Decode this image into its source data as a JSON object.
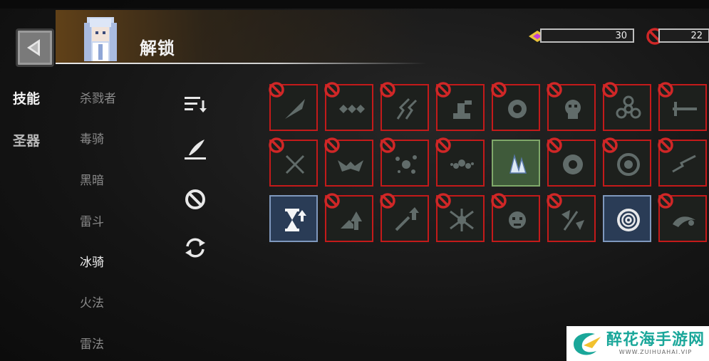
{
  "header": {
    "title": "解锁"
  },
  "resources": [
    {
      "icon": "gem-icon",
      "value": "30"
    },
    {
      "icon": "forbidden-icon",
      "value": "22"
    }
  ],
  "nav": [
    {
      "label": "技能",
      "active": true
    },
    {
      "label": "圣器",
      "active": false
    }
  ],
  "classes": [
    "杀戮者",
    "毒骑",
    "黑暗",
    "雷斗",
    "冰骑",
    "火法",
    "雷法"
  ],
  "selected_class": "冰骑",
  "tools": [
    "sort-icon",
    "feather-icon",
    "ban-filter-icon",
    "refresh-icon"
  ],
  "skills": [
    [
      {
        "icon": "slash-icon",
        "state": "locked"
      },
      {
        "icon": "spiked-chain-icon",
        "state": "locked"
      },
      {
        "icon": "lightning-claw-icon",
        "state": "locked"
      },
      {
        "icon": "fist-strike-icon",
        "state": "locked"
      },
      {
        "icon": "fire-fist-icon",
        "state": "locked"
      },
      {
        "icon": "skull-burst-icon",
        "state": "locked"
      },
      {
        "icon": "biohazard-icon",
        "state": "locked"
      },
      {
        "icon": "lance-icon",
        "state": "locked"
      }
    ],
    [
      {
        "icon": "crossed-swords-icon",
        "state": "locked"
      },
      {
        "icon": "bat-wings-icon",
        "state": "locked"
      },
      {
        "icon": "splatter-icon",
        "state": "locked"
      },
      {
        "icon": "dust-cloud-icon",
        "state": "locked"
      },
      {
        "icon": "ice-crystal-icon",
        "state": "unlocked-green"
      },
      {
        "icon": "whirlwind-icon",
        "state": "locked"
      },
      {
        "icon": "ring-icon",
        "state": "locked"
      },
      {
        "icon": "lightning-bolt-icon",
        "state": "locked"
      }
    ],
    [
      {
        "icon": "hourglass-up-icon",
        "state": "unlocked-blue"
      },
      {
        "icon": "upgrade-arrows-icon",
        "state": "locked"
      },
      {
        "icon": "sword-upgrade-icon",
        "state": "locked"
      },
      {
        "icon": "spike-burst-icon",
        "state": "locked"
      },
      {
        "icon": "rage-face-icon",
        "state": "locked"
      },
      {
        "icon": "axe-arrow-icon",
        "state": "locked"
      },
      {
        "icon": "vortex-icon",
        "state": "unlocked-blue"
      },
      {
        "icon": "meteor-icon",
        "state": "locked"
      }
    ]
  ],
  "watermark": {
    "cn": "醉花海手游网",
    "en": "WWW.ZUIHUAHAI.VIP"
  },
  "colors": {
    "locked_border": "#c41a1a",
    "green_border": "#7fa86a",
    "blue_border": "#7f98bd"
  }
}
